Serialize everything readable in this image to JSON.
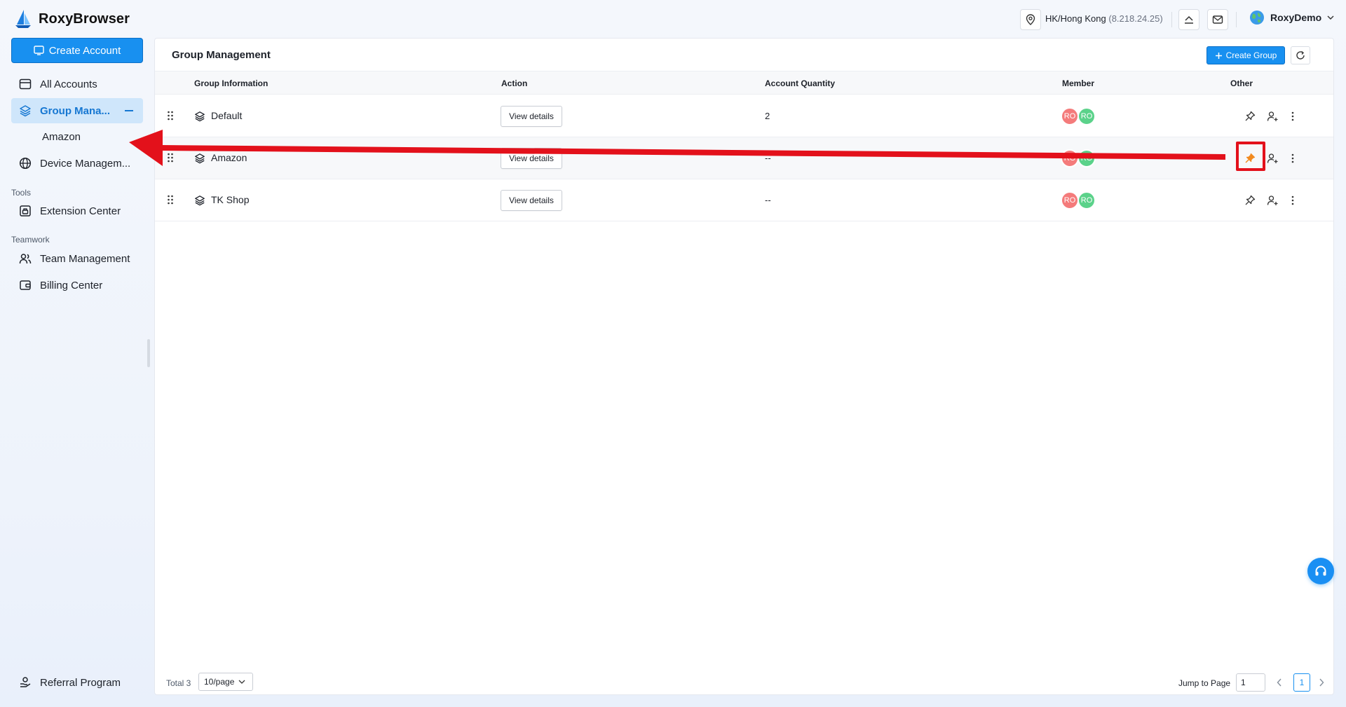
{
  "app": {
    "name": "RoxyBrowser"
  },
  "header": {
    "location": "HK/Hong Kong",
    "ip": "(8.218.24.25)",
    "user": "RoxyDemo"
  },
  "sidebar": {
    "create_account": "Create Account",
    "items": [
      {
        "label": "All Accounts",
        "icon": "browser-window-icon"
      },
      {
        "label": "Group Mana...",
        "icon": "layers-icon",
        "active": true
      },
      {
        "label": "Device Managem...",
        "icon": "globe-icon"
      }
    ],
    "sub_items": [
      "Amazon"
    ],
    "tools_label": "Tools",
    "tools": [
      {
        "label": "Extension Center",
        "icon": "extension-icon"
      }
    ],
    "teamwork_label": "Teamwork",
    "teamwork": [
      {
        "label": "Team Management",
        "icon": "team-icon"
      },
      {
        "label": "Billing Center",
        "icon": "wallet-icon"
      }
    ],
    "referral": "Referral Program"
  },
  "main": {
    "title": "Group Management",
    "create_group": "Create Group",
    "columns": [
      "Group Information",
      "Action",
      "Account Quantity",
      "Member",
      "Other"
    ],
    "rows": [
      {
        "name": "Default",
        "action": "View details",
        "quantity": "2",
        "members": [
          "RO",
          "RO"
        ]
      },
      {
        "name": "Amazon",
        "action": "View details",
        "quantity": "--",
        "members": [
          "RO",
          "RO"
        ],
        "pinned": true
      },
      {
        "name": "TK Shop",
        "action": "View details",
        "quantity": "--",
        "members": [
          "RO",
          "RO"
        ]
      }
    ],
    "pagination": {
      "total": "Total 3",
      "per_page": "10/page",
      "jump_label": "Jump to Page",
      "jump_value": "1",
      "current_page": "1"
    }
  },
  "colors": {
    "accent": "#1890f0",
    "pin_active": "#f28a1e",
    "annotation": "#e3111b"
  }
}
